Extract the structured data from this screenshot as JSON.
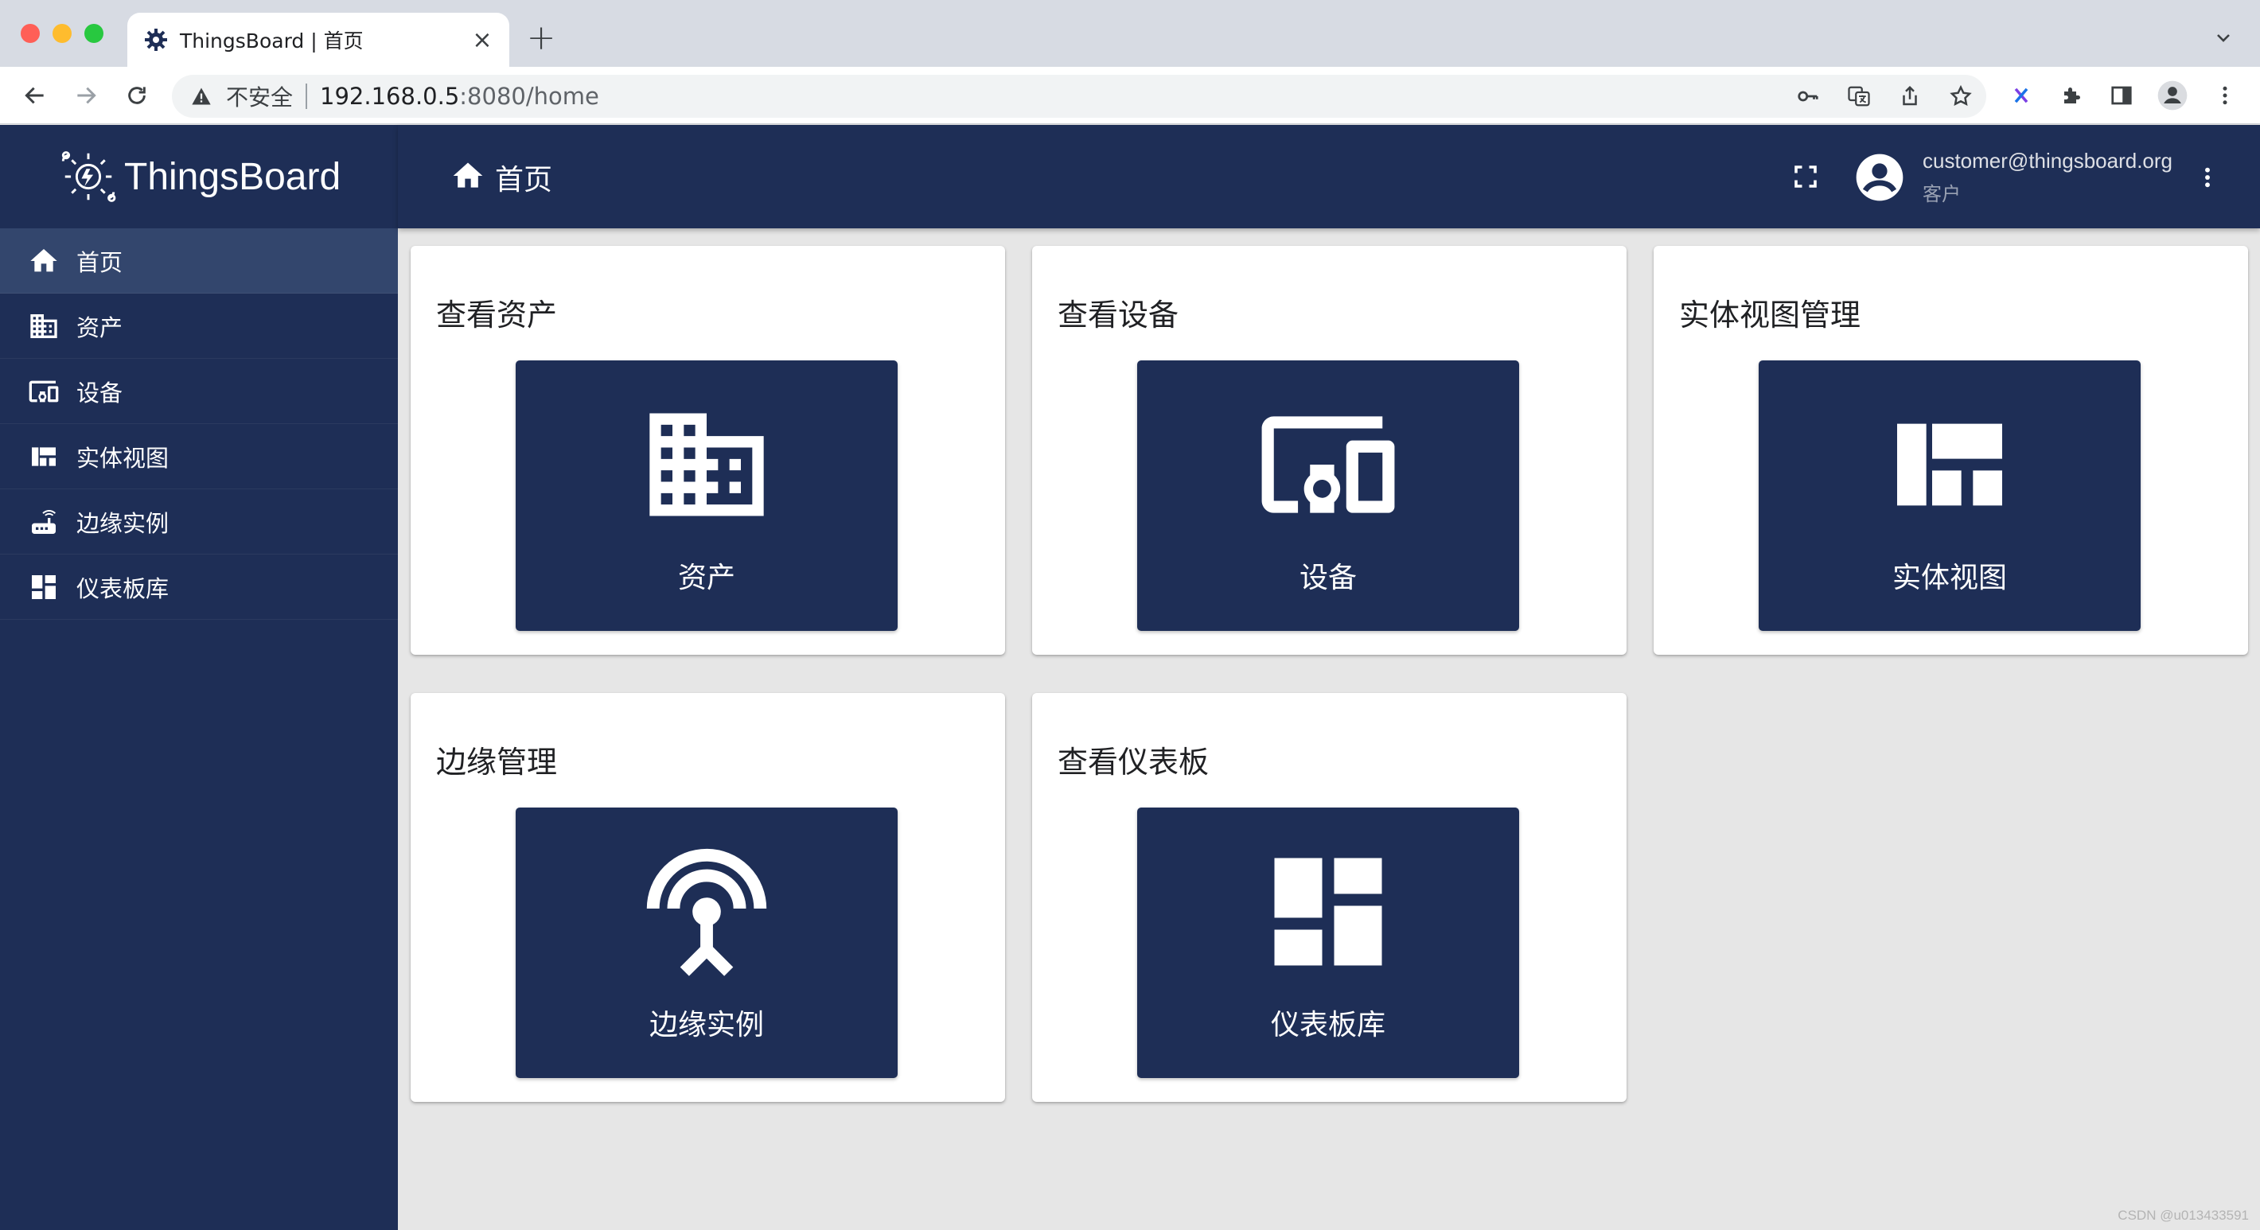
{
  "browser": {
    "tab_title": "ThingsBoard | 首页",
    "tab_close": "×",
    "new_tab": "+",
    "insecure_label": "不安全",
    "url_host": "192.168.0.5",
    "url_rest": ":8080/home"
  },
  "app": {
    "brand": "ThingsBoard",
    "accent": "#1e2e56",
    "sidebar": {
      "items": [
        {
          "label": "首页",
          "icon": "home-icon",
          "active": true
        },
        {
          "label": "资产",
          "icon": "building-icon"
        },
        {
          "label": "设备",
          "icon": "devices-icon"
        },
        {
          "label": "实体视图",
          "icon": "entity-view-icon"
        },
        {
          "label": "边缘实例",
          "icon": "router-icon"
        },
        {
          "label": "仪表板库",
          "icon": "dashboard-icon"
        }
      ]
    },
    "header": {
      "breadcrumb": "首页",
      "user_email": "customer@thingsboard.org",
      "user_role": "客户"
    },
    "cards": [
      {
        "title": "查看资产",
        "tile_label": "资产",
        "icon": "building-icon"
      },
      {
        "title": "查看设备",
        "tile_label": "设备",
        "icon": "devices-icon"
      },
      {
        "title": "实体视图管理",
        "tile_label": "实体视图",
        "icon": "entity-view-icon"
      },
      {
        "title": "边缘管理",
        "tile_label": "边缘实例",
        "icon": "router-icon"
      },
      {
        "title": "查看仪表板",
        "tile_label": "仪表板库",
        "icon": "dashboard-icon"
      }
    ]
  },
  "watermark": "CSDN @u013433591"
}
